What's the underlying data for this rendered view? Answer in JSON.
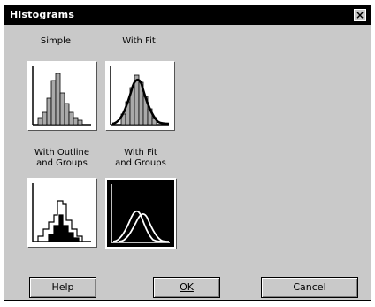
{
  "window": {
    "title": "Histograms",
    "close_label": "×"
  },
  "options": [
    {
      "label": "Simple",
      "style": "simple"
    },
    {
      "label": "With Fit",
      "style": "fit"
    },
    {
      "label": "With Outline\nand Groups",
      "style": "outline"
    },
    {
      "label": "With Fit\nand Groups",
      "style": "fitgroups"
    }
  ],
  "buttons": {
    "help": "Help",
    "ok": "OK",
    "cancel": "Cancel"
  },
  "colors": {
    "dialog_bg": "#c9c9c9",
    "title_bg": "#000000",
    "bar_fill": "#a9a9a9"
  }
}
